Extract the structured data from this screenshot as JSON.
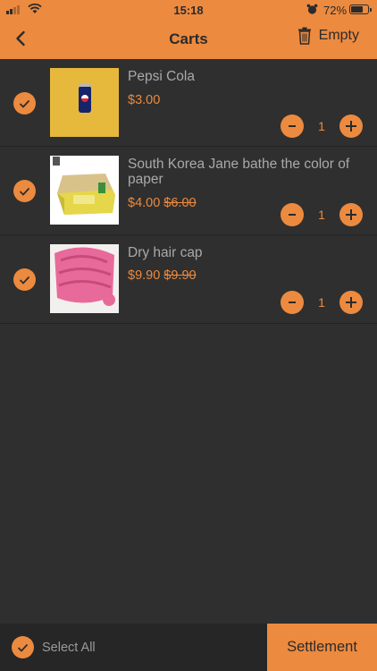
{
  "status_bar": {
    "time": "15:18",
    "battery": "72%"
  },
  "header": {
    "title": "Carts",
    "empty_label": "Empty"
  },
  "cart": {
    "items": [
      {
        "name": "Pepsi Cola",
        "price": "$3.00",
        "original_price": "",
        "quantity": "1",
        "selected": true
      },
      {
        "name": "South Korea Jane bathe the color of paper",
        "price": "$4.00",
        "original_price": "$6.00",
        "quantity": "1",
        "selected": true
      },
      {
        "name": "Dry hair cap",
        "price": "$9.90",
        "original_price": "$9.90",
        "quantity": "1",
        "selected": true
      }
    ]
  },
  "footer": {
    "select_all_label": "Select All",
    "settlement_label": "Settlement"
  },
  "colors": {
    "accent": "#ec8a3f",
    "background": "#2f2f2f",
    "footer": "#262626"
  }
}
